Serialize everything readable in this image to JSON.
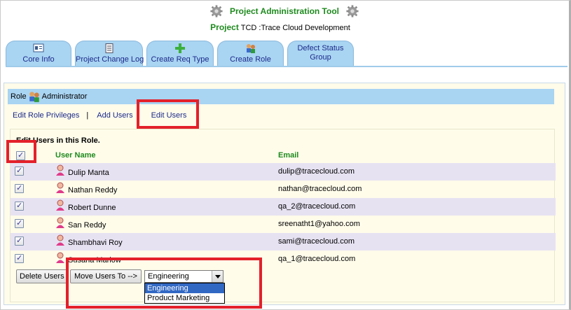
{
  "header": {
    "app_title": "Project Administration Tool",
    "project_label": "Project",
    "project_value": "TCD :Trace Cloud Development"
  },
  "tabs": [
    {
      "label": "Core Info",
      "icon": "id-card-icon"
    },
    {
      "label": "Project Change Log",
      "icon": "document-icon"
    },
    {
      "label": "Create Req Type",
      "icon": "green-plus-icon"
    },
    {
      "label": "Create Role",
      "icon": "users-icon"
    },
    {
      "label": "Defect Status Group",
      "icon": ""
    }
  ],
  "role": {
    "label": "Role",
    "name": "Administrator"
  },
  "subnav": {
    "edit_privileges": "Edit Role Privileges",
    "separator": "|",
    "add_users": "Add Users",
    "edit_users": "Edit Users"
  },
  "section": {
    "title": "Edit Users in this Role."
  },
  "table": {
    "col_user": "User Name",
    "col_email": "Email",
    "rows": [
      {
        "name": "Dulip  Manta",
        "email": "dulip@tracecloud.com",
        "checked": true
      },
      {
        "name": "Nathan  Reddy",
        "email": "nathan@tracecloud.com",
        "checked": true
      },
      {
        "name": "Robert  Dunne",
        "email": "qa_2@tracecloud.com",
        "checked": true
      },
      {
        "name": "San  Reddy",
        "email": "sreenatht1@yahoo.com",
        "checked": true
      },
      {
        "name": "Shambhavi  Roy",
        "email": "sami@tracecloud.com",
        "checked": true
      },
      {
        "name": "Susana  Marlow",
        "email": "qa_1@tracecloud.com",
        "checked": true
      }
    ]
  },
  "actions": {
    "delete_label": "Delete Users",
    "move_label": "Move Users To -->",
    "move_target_selected": "Engineering",
    "move_target_options": [
      "Engineering",
      "Product Marketing"
    ]
  },
  "colors": {
    "accent_green": "#1e8a1e",
    "tab_blue": "#a9d4f2",
    "link_blue": "#1b2a8a",
    "highlight_red": "#e3202a",
    "row_alt": "#e7e2f2",
    "panel_bg": "#fffcea"
  }
}
